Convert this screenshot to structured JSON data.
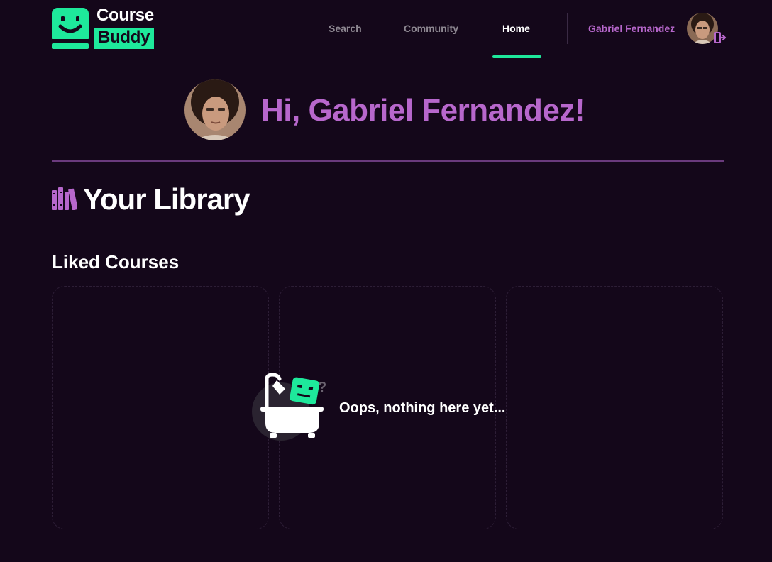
{
  "app": {
    "logo_line1": "Course",
    "logo_line2": "Buddy"
  },
  "nav": {
    "items": [
      {
        "label": "Search",
        "active": false
      },
      {
        "label": "Community",
        "active": false
      },
      {
        "label": "Home",
        "active": true
      }
    ]
  },
  "user": {
    "name": "Gabriel Fernandez"
  },
  "greeting": {
    "text": "Hi, Gabriel Fernandez!"
  },
  "library": {
    "title": "Your Library",
    "section_title": "Liked Courses",
    "empty_message": "Oops, nothing here yet..."
  },
  "colors": {
    "background": "#14071a",
    "accent_green": "#1ee89b",
    "accent_purple": "#b767cc",
    "nav_inactive": "#8d8791"
  },
  "icons": {
    "logo": "smiley-face-logo-icon",
    "logout": "logout-icon",
    "library": "bookshelf-icon",
    "empty": "bathtub-robot-icon"
  }
}
